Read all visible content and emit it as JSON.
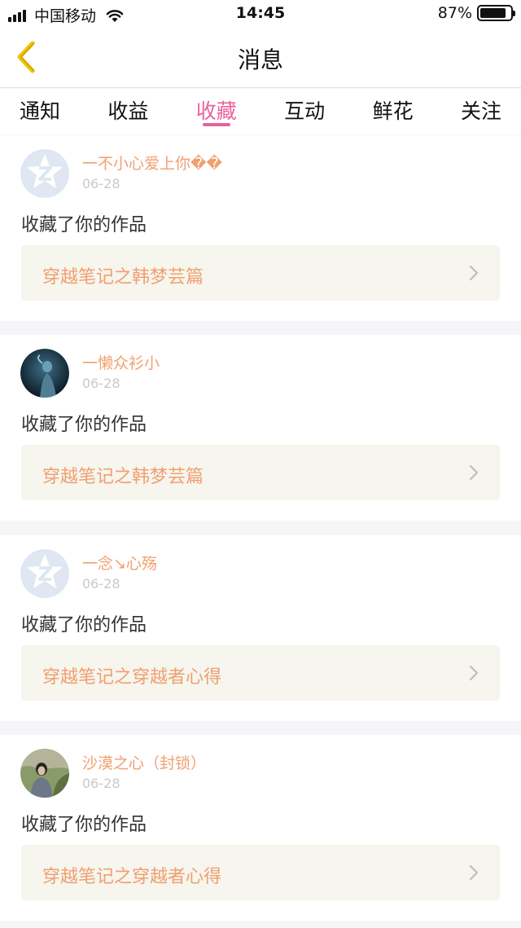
{
  "status_bar": {
    "carrier": "中国移动",
    "time": "14:45",
    "battery": "87%",
    "battery_level": 0.87
  },
  "nav": {
    "title": "消息"
  },
  "tabs": [
    {
      "label": "通知"
    },
    {
      "label": "收益"
    },
    {
      "label": "收藏"
    },
    {
      "label": "互动"
    },
    {
      "label": "鲜花"
    },
    {
      "label": "关注"
    }
  ],
  "active_tab": "收藏",
  "colors": {
    "accent": "#e8629c",
    "username": "#f0a070",
    "link_bg": "#f6f5ee"
  },
  "messages": [
    {
      "user": "一不小心爱上你��",
      "date": "06-28",
      "action": "收藏了你的作品",
      "work": "穿越笔记之韩梦芸篇",
      "avatar": "default-q-avatar-icon"
    },
    {
      "user": "一懒众衫小",
      "date": "06-28",
      "action": "收藏了你的作品",
      "work": "穿越笔记之韩梦芸篇",
      "avatar": "photo-avatar-dark"
    },
    {
      "user": "一念↘心殇",
      "date": "06-28",
      "action": "收藏了你的作品",
      "work": "穿越笔记之穿越者心得",
      "avatar": "default-q-avatar-icon"
    },
    {
      "user": "沙漠之心（封锁）",
      "date": "06-28",
      "action": "收藏了你的作品",
      "work": "穿越笔记之穿越者心得",
      "avatar": "photo-avatar-outdoor"
    }
  ]
}
